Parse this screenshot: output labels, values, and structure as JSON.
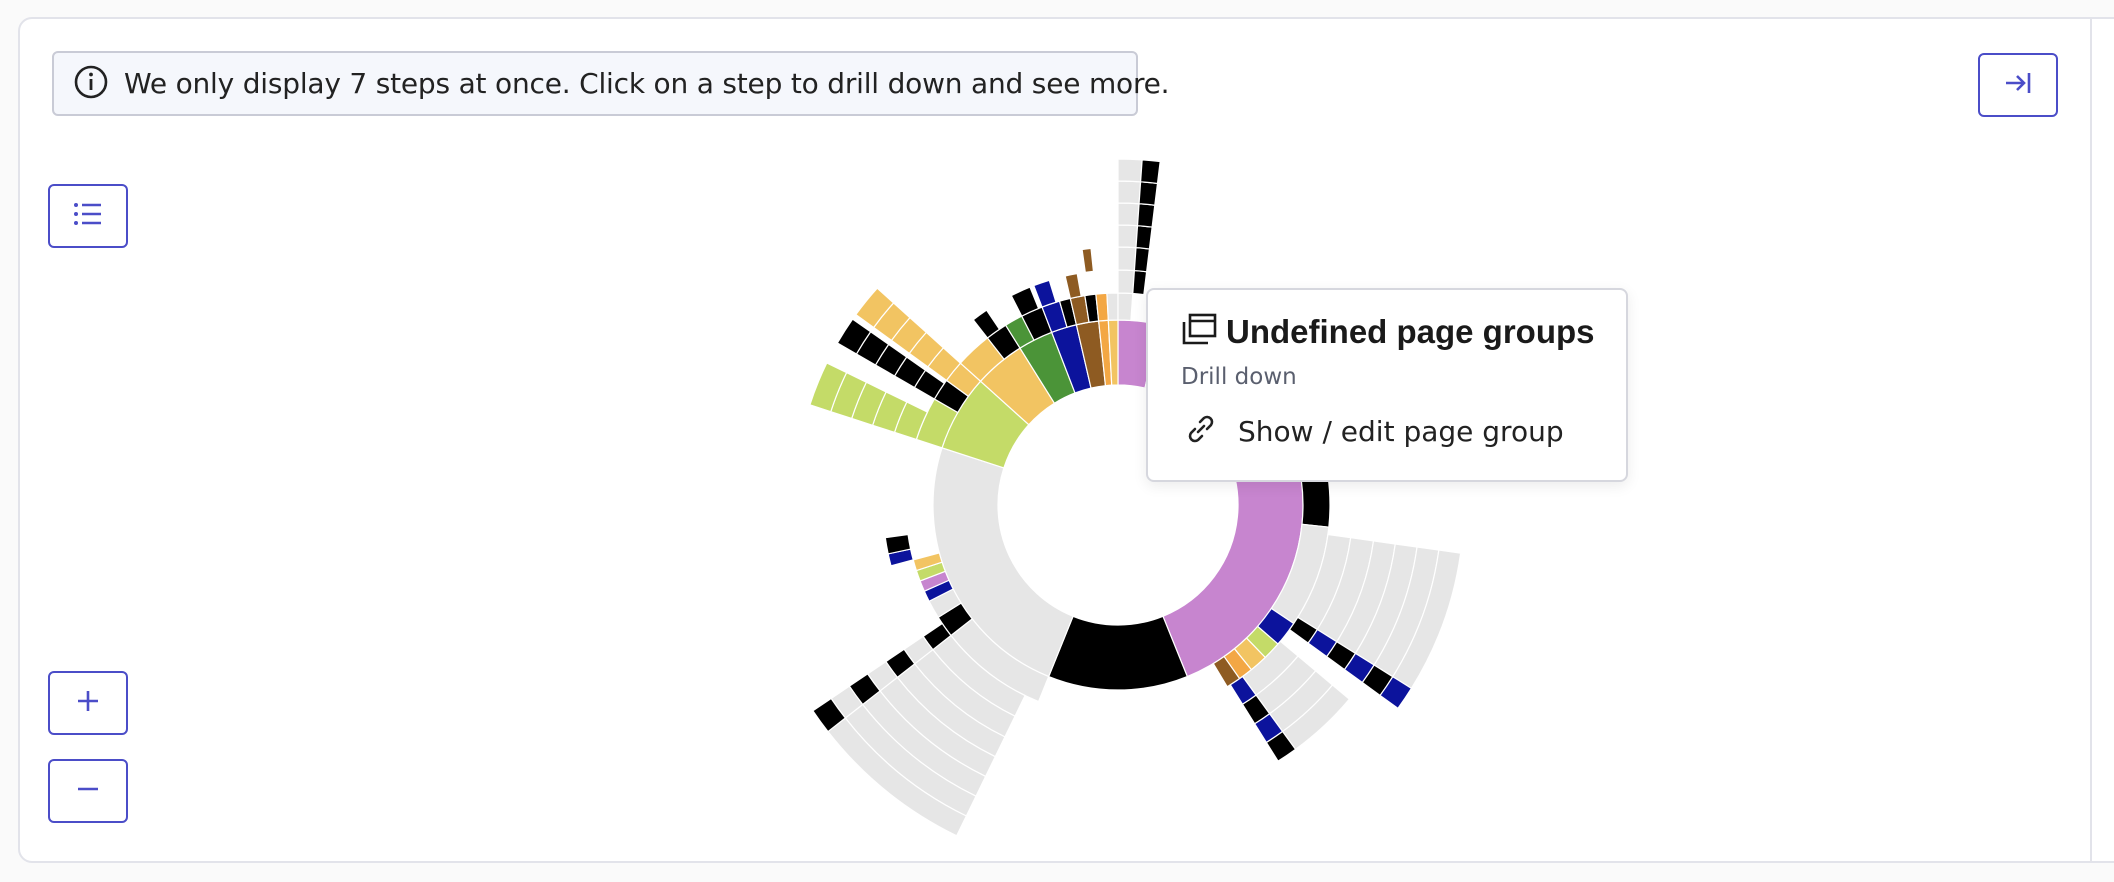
{
  "notice": {
    "text": "We only display 7 steps at once. Click on a step to drill down and see more.",
    "icon": "info-circle-icon"
  },
  "toolbar": {
    "collapse_icon": "arrow-right-to-line-icon",
    "list_icon": "list-icon",
    "zoom_in_icon": "plus-icon",
    "zoom_out_icon": "minus-icon"
  },
  "popover": {
    "title": "Undefined page groups",
    "title_icon": "page-groups-icon",
    "drill_down": "Drill down",
    "link_label": "Show / edit page group",
    "link_icon": "link-icon"
  },
  "colors": {
    "accent": "#4b4dc8",
    "undefined_group": "#c785cf",
    "neutral": "#e6e6e6",
    "exit": "#000000",
    "lime": "#c4db68",
    "yellow": "#f2c462",
    "green": "#4b9438",
    "navy": "#0c139c",
    "brown": "#8e5b22",
    "orange": "#f3a744"
  }
}
